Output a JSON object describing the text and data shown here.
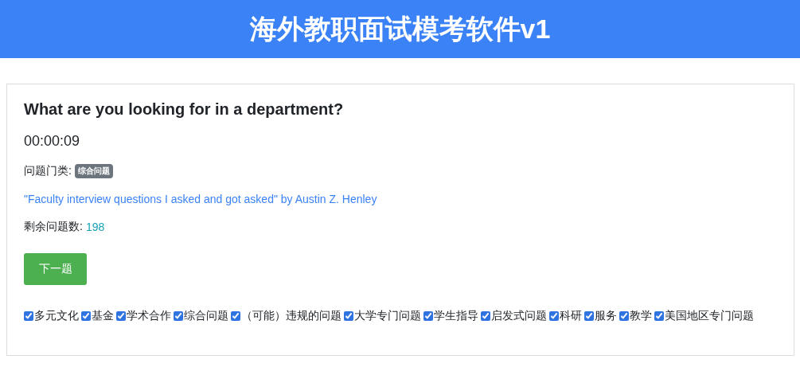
{
  "header": {
    "title": "海外教职面试模考软件v1"
  },
  "question": "What are you looking for in a department?",
  "timer": "00:00:09",
  "category": {
    "label": "问题门类:",
    "badge": "综合问题"
  },
  "source_link": "\"Faculty interview questions I asked and got asked\" by Austin Z. Henley",
  "remaining": {
    "label": "剩余问题数:",
    "count": "198"
  },
  "next_button": "下一题",
  "filters": [
    {
      "label": "多元文化",
      "checked": true
    },
    {
      "label": "基金",
      "checked": true
    },
    {
      "label": "学术合作",
      "checked": true
    },
    {
      "label": "综合问题",
      "checked": true
    },
    {
      "label": "（可能）违规的问题",
      "checked": true
    },
    {
      "label": "大学专门问题",
      "checked": true
    },
    {
      "label": "学生指导",
      "checked": true
    },
    {
      "label": "启发式问题",
      "checked": true
    },
    {
      "label": "科研",
      "checked": true
    },
    {
      "label": "服务",
      "checked": true
    },
    {
      "label": "教学",
      "checked": true
    },
    {
      "label": "美国地区专门问题",
      "checked": true
    }
  ]
}
